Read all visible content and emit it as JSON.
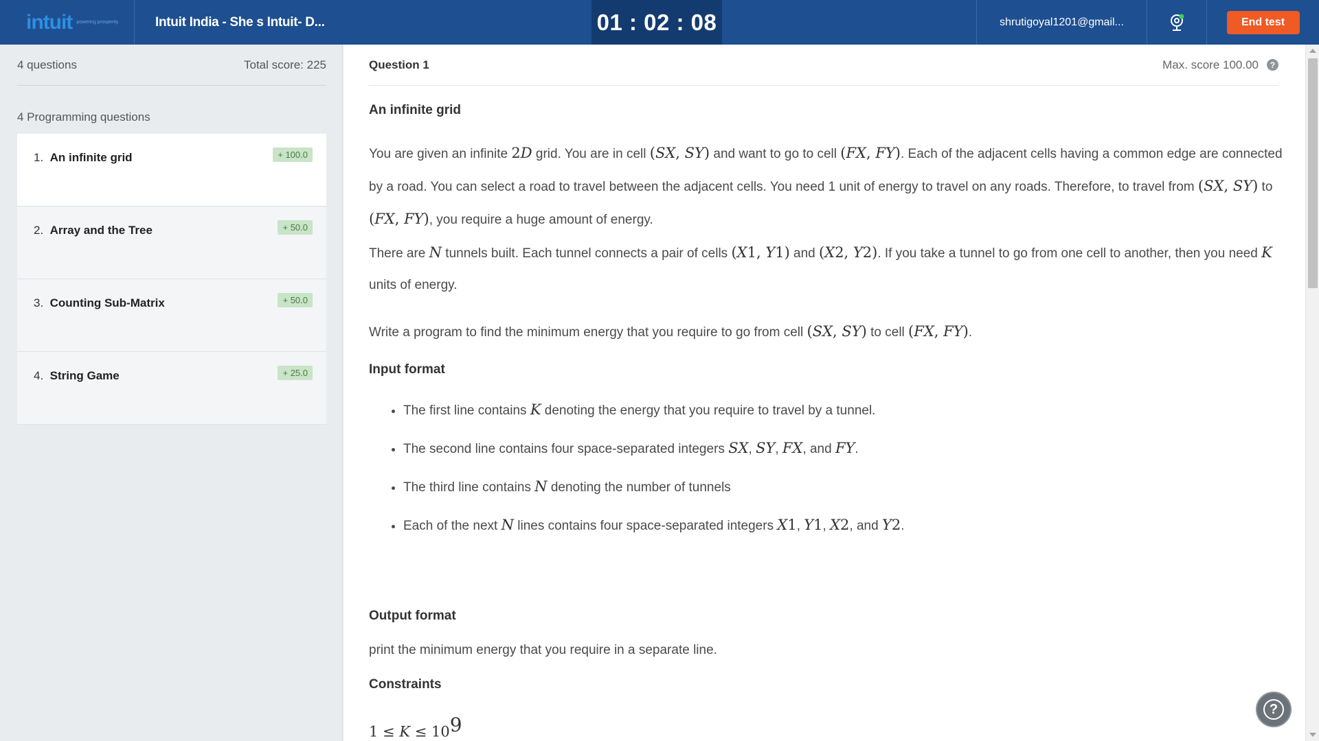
{
  "header": {
    "logo_text": "intuit",
    "logo_tagline": "powering prosperity",
    "test_title": "Intuit India - She s Intuit- D...",
    "timer": "01 : 02 : 08",
    "user_email": "shrutigoyal1201@gmail...",
    "end_test_label": "End test"
  },
  "sidebar": {
    "questions_count": "4 questions",
    "total_score": "Total score: 225",
    "section_label": "4 Programming questions",
    "items": [
      {
        "number": "1.",
        "title": "An infinite grid",
        "score": "+ 100.0"
      },
      {
        "number": "2.",
        "title": "Array and the Tree",
        "score": "+ 50.0"
      },
      {
        "number": "3.",
        "title": "Counting Sub-Matrix",
        "score": "+ 50.0"
      },
      {
        "number": "4.",
        "title": "String Game",
        "score": "+ 25.0"
      }
    ]
  },
  "question": {
    "label": "Question  1",
    "max_score": "Max. score 100.00",
    "title": "An infinite grid",
    "input_heading": "Input format",
    "output_heading": "Output format",
    "output_text": "print the minimum energy that you require in a separate line.",
    "constraints_heading": "Constraints"
  },
  "colors": {
    "header_bg": "#1d4f91",
    "timer_bg": "#143b70",
    "end_button": "#f05a24",
    "score_badge": "#c9e4c7"
  }
}
